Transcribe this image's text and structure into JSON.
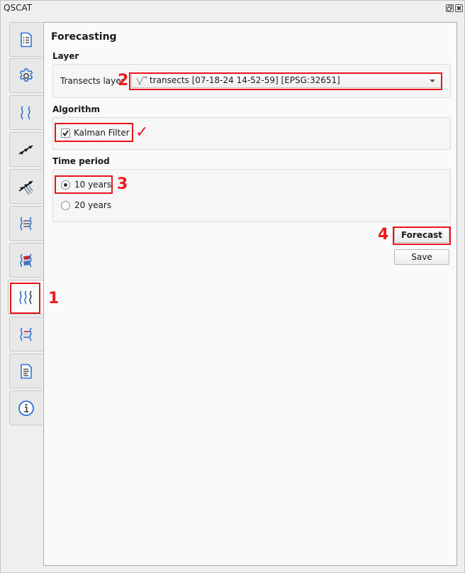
{
  "window": {
    "title": "QSCAT",
    "float_button": "float-icon",
    "close_button": "close-icon"
  },
  "tabs": [
    {
      "name": "project-settings",
      "icon": "list-document-icon",
      "active": false
    },
    {
      "name": "settings",
      "icon": "gear-icon",
      "active": false
    },
    {
      "name": "shorelines",
      "icon": "wavy-lines-icon",
      "active": false
    },
    {
      "name": "transects",
      "icon": "arrows-icon",
      "active": false
    },
    {
      "name": "transects-multiple",
      "icon": "multi-arrows-icon",
      "active": false
    },
    {
      "name": "shoreline-change",
      "icon": "shoreline-change-icon",
      "active": false
    },
    {
      "name": "area-change",
      "icon": "area-change-icon",
      "active": false
    },
    {
      "name": "forecasting",
      "icon": "triple-wave-icon",
      "active": true
    },
    {
      "name": "visualization",
      "icon": "colored-change-icon",
      "active": false
    },
    {
      "name": "summary-reports",
      "icon": "report-icon",
      "active": false
    },
    {
      "name": "about",
      "icon": "info-icon",
      "active": false
    }
  ],
  "panel": {
    "title": "Forecasting",
    "layer": {
      "section_label": "Layer",
      "field_label": "Transects layer",
      "selected_value": "transects [07-18-24 14-52-59] [EPSG:32651]",
      "value_icon": "line-layer-icon"
    },
    "algorithm": {
      "section_label": "Algorithm",
      "options": [
        {
          "label": "Kalman Filter",
          "checked": true
        }
      ]
    },
    "time_period": {
      "section_label": "Time period",
      "options": [
        {
          "label": "10 years",
          "selected": true
        },
        {
          "label": "20 years",
          "selected": false
        }
      ]
    },
    "buttons": {
      "forecast": "Forecast",
      "save": "Save"
    }
  },
  "annotations": {
    "step1": "1",
    "step2": "2",
    "step3": "3",
    "step4": "4",
    "checkmark": "✓",
    "color": "#ee1a1f"
  }
}
